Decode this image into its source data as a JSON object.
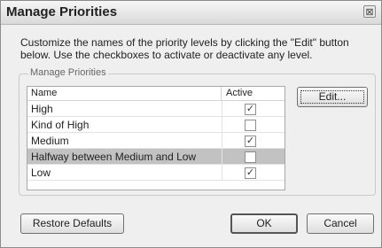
{
  "window": {
    "title": "Manage Priorities",
    "close_glyph": "⊠"
  },
  "instructions": "Customize the names of the priority levels by clicking the \"Edit\" button below. Use the checkboxes to activate or deactivate any level.",
  "group": {
    "label": "Manage Priorities",
    "columns": [
      "Name",
      "Active"
    ],
    "rows": [
      {
        "name": "High",
        "active": true,
        "selected": false
      },
      {
        "name": "Kind of High",
        "active": false,
        "selected": false
      },
      {
        "name": "Medium",
        "active": true,
        "selected": false
      },
      {
        "name": "Halfway between Medium and Low",
        "active": false,
        "selected": true
      },
      {
        "name": "Low",
        "active": true,
        "selected": false
      }
    ],
    "edit_label": "Edit..."
  },
  "buttons": {
    "restore": "Restore Defaults",
    "ok": "OK",
    "cancel": "Cancel"
  }
}
